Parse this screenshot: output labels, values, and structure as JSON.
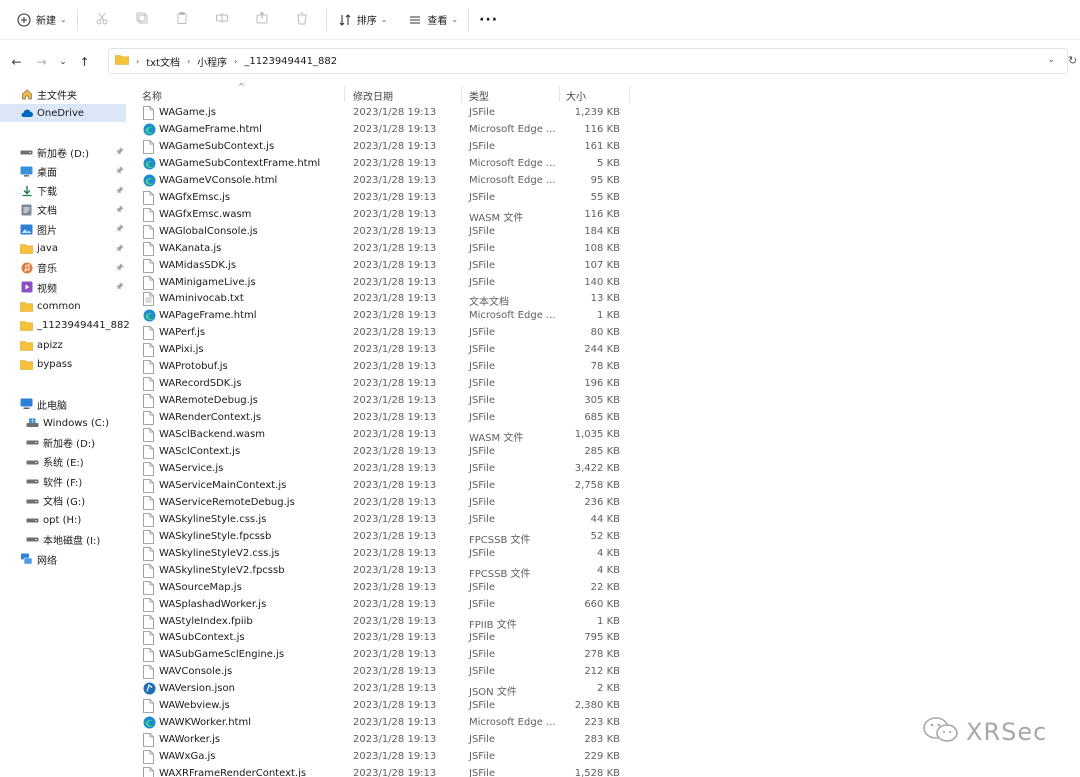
{
  "toolbar": {
    "new_label": "新建",
    "sort_label": "排序",
    "view_label": "查看",
    "more_label": "···"
  },
  "breadcrumb": [
    "txt文档",
    "小程序",
    "_1123949441_882"
  ],
  "sidebar": {
    "quick": [
      {
        "label": "主文件夹",
        "icon": "home-icon"
      },
      {
        "label": "OneDrive",
        "icon": "cloud-icon",
        "selected": true
      }
    ],
    "pinned": [
      {
        "label": "新加卷 (D:)",
        "icon": "drive-icon",
        "pinned": true
      },
      {
        "label": "桌面",
        "icon": "desktop-icon",
        "pinned": true
      },
      {
        "label": "下载",
        "icon": "download-icon",
        "pinned": true
      },
      {
        "label": "文档",
        "icon": "document-icon",
        "pinned": true
      },
      {
        "label": "图片",
        "icon": "picture-icon",
        "pinned": true
      },
      {
        "label": "java",
        "icon": "folder-icon",
        "pinned": true
      },
      {
        "label": "音乐",
        "icon": "music-icon",
        "pinned": true
      },
      {
        "label": "视频",
        "icon": "video-icon",
        "pinned": true
      },
      {
        "label": "common",
        "icon": "folder-icon"
      },
      {
        "label": "_1123949441_882",
        "icon": "folder-icon"
      },
      {
        "label": "apizz",
        "icon": "folder-icon"
      },
      {
        "label": "bypass",
        "icon": "folder-icon"
      }
    ],
    "this_pc": {
      "label": "此电脑",
      "icon": "computer-icon"
    },
    "drives": [
      {
        "label": "Windows (C:)",
        "icon": "windows-drive-icon"
      },
      {
        "label": "新加卷 (D:)",
        "icon": "drive-icon"
      },
      {
        "label": "系统 (E:)",
        "icon": "drive-icon"
      },
      {
        "label": "软件 (F:)",
        "icon": "drive-icon"
      },
      {
        "label": "文档 (G:)",
        "icon": "drive-icon"
      },
      {
        "label": "opt (H:)",
        "icon": "drive-icon"
      },
      {
        "label": "本地磁盘 (I:)",
        "icon": "drive-icon"
      }
    ],
    "network": {
      "label": "网络",
      "icon": "network-icon"
    }
  },
  "columns": {
    "name": "名称",
    "date": "修改日期",
    "type": "类型",
    "size": "大小"
  },
  "files": [
    {
      "name": "WAGame.js",
      "date": "2023/1/28 19:13",
      "type": "JSFile",
      "size": "1,239 KB",
      "icon": "file-icon"
    },
    {
      "name": "WAGameFrame.html",
      "date": "2023/1/28 19:13",
      "type": "Microsoft Edge ...",
      "size": "116 KB",
      "icon": "edge-icon"
    },
    {
      "name": "WAGameSubContext.js",
      "date": "2023/1/28 19:13",
      "type": "JSFile",
      "size": "161 KB",
      "icon": "file-icon"
    },
    {
      "name": "WAGameSubContextFrame.html",
      "date": "2023/1/28 19:13",
      "type": "Microsoft Edge ...",
      "size": "5 KB",
      "icon": "edge-icon"
    },
    {
      "name": "WAGameVConsole.html",
      "date": "2023/1/28 19:13",
      "type": "Microsoft Edge ...",
      "size": "95 KB",
      "icon": "edge-icon"
    },
    {
      "name": "WAGfxEmsc.js",
      "date": "2023/1/28 19:13",
      "type": "JSFile",
      "size": "55 KB",
      "icon": "file-icon"
    },
    {
      "name": "WAGfxEmsc.wasm",
      "date": "2023/1/28 19:13",
      "type": "WASM 文件",
      "size": "116 KB",
      "icon": "file-icon"
    },
    {
      "name": "WAGlobalConsole.js",
      "date": "2023/1/28 19:13",
      "type": "JSFile",
      "size": "184 KB",
      "icon": "file-icon"
    },
    {
      "name": "WAKanata.js",
      "date": "2023/1/28 19:13",
      "type": "JSFile",
      "size": "108 KB",
      "icon": "file-icon"
    },
    {
      "name": "WAMidasSDK.js",
      "date": "2023/1/28 19:13",
      "type": "JSFile",
      "size": "107 KB",
      "icon": "file-icon"
    },
    {
      "name": "WAMinigameLive.js",
      "date": "2023/1/28 19:13",
      "type": "JSFile",
      "size": "140 KB",
      "icon": "file-icon"
    },
    {
      "name": "WAminivocab.txt",
      "date": "2023/1/28 19:13",
      "type": "文本文档",
      "size": "13 KB",
      "icon": "text-file-icon"
    },
    {
      "name": "WAPageFrame.html",
      "date": "2023/1/28 19:13",
      "type": "Microsoft Edge ...",
      "size": "1 KB",
      "icon": "edge-icon"
    },
    {
      "name": "WAPerf.js",
      "date": "2023/1/28 19:13",
      "type": "JSFile",
      "size": "80 KB",
      "icon": "file-icon"
    },
    {
      "name": "WAPixi.js",
      "date": "2023/1/28 19:13",
      "type": "JSFile",
      "size": "244 KB",
      "icon": "file-icon"
    },
    {
      "name": "WAProtobuf.js",
      "date": "2023/1/28 19:13",
      "type": "JSFile",
      "size": "78 KB",
      "icon": "file-icon"
    },
    {
      "name": "WARecordSDK.js",
      "date": "2023/1/28 19:13",
      "type": "JSFile",
      "size": "196 KB",
      "icon": "file-icon"
    },
    {
      "name": "WARemoteDebug.js",
      "date": "2023/1/28 19:13",
      "type": "JSFile",
      "size": "305 KB",
      "icon": "file-icon"
    },
    {
      "name": "WARenderContext.js",
      "date": "2023/1/28 19:13",
      "type": "JSFile",
      "size": "685 KB",
      "icon": "file-icon"
    },
    {
      "name": "WASclBackend.wasm",
      "date": "2023/1/28 19:13",
      "type": "WASM 文件",
      "size": "1,035 KB",
      "icon": "file-icon"
    },
    {
      "name": "WASclContext.js",
      "date": "2023/1/28 19:13",
      "type": "JSFile",
      "size": "285 KB",
      "icon": "file-icon"
    },
    {
      "name": "WAService.js",
      "date": "2023/1/28 19:13",
      "type": "JSFile",
      "size": "3,422 KB",
      "icon": "file-icon"
    },
    {
      "name": "WAServiceMainContext.js",
      "date": "2023/1/28 19:13",
      "type": "JSFile",
      "size": "2,758 KB",
      "icon": "file-icon"
    },
    {
      "name": "WAServiceRemoteDebug.js",
      "date": "2023/1/28 19:13",
      "type": "JSFile",
      "size": "236 KB",
      "icon": "file-icon"
    },
    {
      "name": "WASkylineStyle.css.js",
      "date": "2023/1/28 19:13",
      "type": "JSFile",
      "size": "44 KB",
      "icon": "file-icon"
    },
    {
      "name": "WASkylineStyle.fpcssb",
      "date": "2023/1/28 19:13",
      "type": "FPCSSB 文件",
      "size": "52 KB",
      "icon": "file-icon"
    },
    {
      "name": "WASkylineStyleV2.css.js",
      "date": "2023/1/28 19:13",
      "type": "JSFile",
      "size": "4 KB",
      "icon": "file-icon"
    },
    {
      "name": "WASkylineStyleV2.fpcssb",
      "date": "2023/1/28 19:13",
      "type": "FPCSSB 文件",
      "size": "4 KB",
      "icon": "file-icon"
    },
    {
      "name": "WASourceMap.js",
      "date": "2023/1/28 19:13",
      "type": "JSFile",
      "size": "22 KB",
      "icon": "file-icon"
    },
    {
      "name": "WASplashadWorker.js",
      "date": "2023/1/28 19:13",
      "type": "JSFile",
      "size": "660 KB",
      "icon": "file-icon"
    },
    {
      "name": "WAStyleIndex.fpiib",
      "date": "2023/1/28 19:13",
      "type": "FPIIB 文件",
      "size": "1 KB",
      "icon": "file-icon"
    },
    {
      "name": "WASubContext.js",
      "date": "2023/1/28 19:13",
      "type": "JSFile",
      "size": "795 KB",
      "icon": "file-icon"
    },
    {
      "name": "WASubGameSclEngine.js",
      "date": "2023/1/28 19:13",
      "type": "JSFile",
      "size": "278 KB",
      "icon": "file-icon"
    },
    {
      "name": "WAVConsole.js",
      "date": "2023/1/28 19:13",
      "type": "JSFile",
      "size": "212 KB",
      "icon": "file-icon"
    },
    {
      "name": "WAVersion.json",
      "date": "2023/1/28 19:13",
      "type": "JSON 文件",
      "size": "2 KB",
      "icon": "json-icon"
    },
    {
      "name": "WAWebview.js",
      "date": "2023/1/28 19:13",
      "type": "JSFile",
      "size": "2,380 KB",
      "icon": "file-icon"
    },
    {
      "name": "WAWKWorker.html",
      "date": "2023/1/28 19:13",
      "type": "Microsoft Edge ...",
      "size": "223 KB",
      "icon": "edge-icon"
    },
    {
      "name": "WAWorker.js",
      "date": "2023/1/28 19:13",
      "type": "JSFile",
      "size": "283 KB",
      "icon": "file-icon"
    },
    {
      "name": "WAWxGa.js",
      "date": "2023/1/28 19:13",
      "type": "JSFile",
      "size": "229 KB",
      "icon": "file-icon"
    },
    {
      "name": "WAXRFrameRenderContext.js",
      "date": "2023/1/28 19:13",
      "type": "JSFile",
      "size": "1,528 KB",
      "icon": "file-icon"
    }
  ],
  "watermark": {
    "text": "XRSec",
    "icon": "wechat-icon"
  },
  "colors": {
    "accent": "#0067c0",
    "selected_bg": "#dbe7f7",
    "folder": "#f5c33b"
  }
}
